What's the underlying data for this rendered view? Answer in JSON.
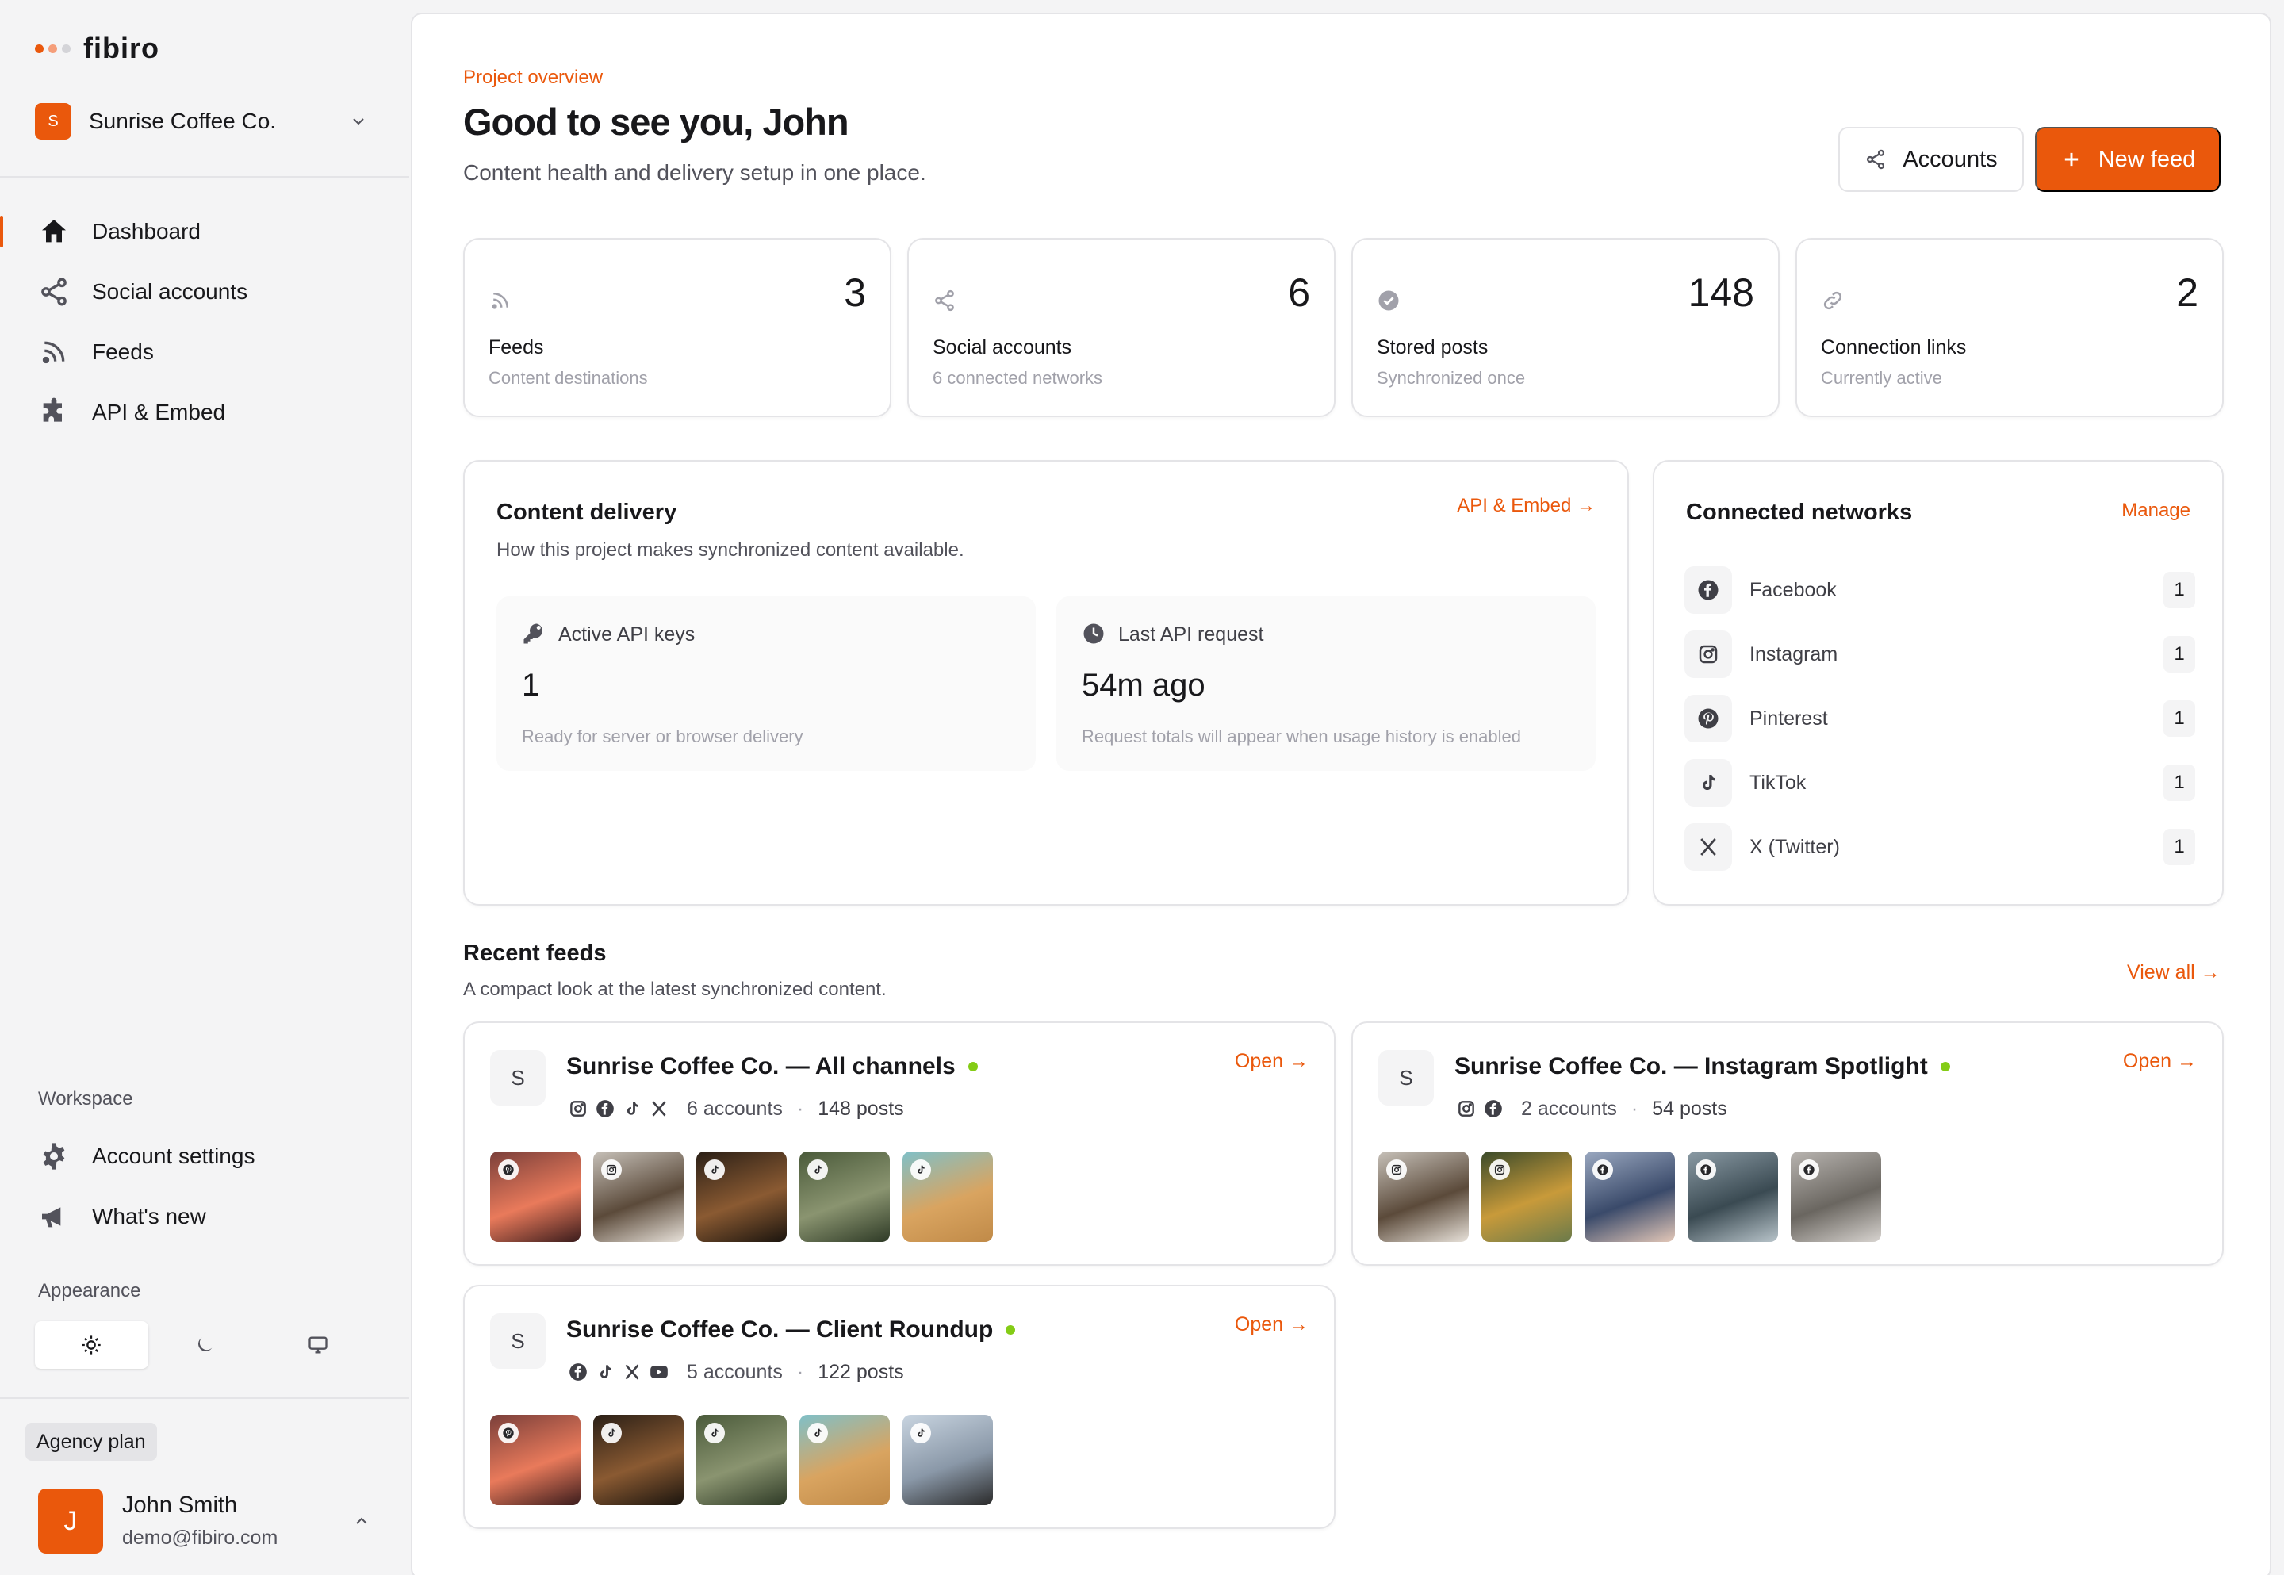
{
  "brand": {
    "name": "fibiro",
    "dot_colors": [
      "#ea580c",
      "#f59e7a",
      "#d4d4d8"
    ]
  },
  "project": {
    "initial": "S",
    "name": "Sunrise Coffee Co."
  },
  "nav": [
    {
      "label": "Dashboard",
      "icon": "home-icon",
      "active": true
    },
    {
      "label": "Social accounts",
      "icon": "share-icon",
      "active": false
    },
    {
      "label": "Feeds",
      "icon": "rss-icon",
      "active": false
    },
    {
      "label": "API & Embed",
      "icon": "puzzle-icon",
      "active": false
    }
  ],
  "workspace": {
    "label": "Workspace",
    "items": [
      {
        "label": "Account settings",
        "icon": "gear-icon"
      },
      {
        "label": "What's new",
        "icon": "megaphone-icon"
      }
    ]
  },
  "appearance": {
    "label": "Appearance",
    "options": [
      "sun-icon",
      "moon-icon",
      "monitor-icon"
    ],
    "selected": "sun-icon"
  },
  "plan": {
    "label": "Agency plan"
  },
  "user": {
    "initial": "J",
    "name": "John Smith",
    "email": "demo@fibiro.com"
  },
  "header": {
    "eyebrow": "Project overview",
    "title": "Good to see you, John",
    "subtitle": "Content health and delivery setup in one place.",
    "accounts_button": "Accounts",
    "new_feed_button": "New feed"
  },
  "stats": [
    {
      "value": "3",
      "label": "Feeds",
      "sub": "Content destinations",
      "icon": "rss-icon"
    },
    {
      "value": "6",
      "label": "Social accounts",
      "sub": "6 connected networks",
      "icon": "share-icon"
    },
    {
      "value": "148",
      "label": "Stored posts",
      "sub": "Synchronized once",
      "icon": "check-circle-icon"
    },
    {
      "value": "2",
      "label": "Connection links",
      "sub": "Currently active",
      "icon": "link-icon"
    }
  ],
  "delivery": {
    "title": "Content delivery",
    "desc": "How this project makes synchronized content available.",
    "link": "API & Embed →",
    "boxes": [
      {
        "label": "Active API keys",
        "value": "1",
        "sub": "Ready for server or browser delivery",
        "icon": "key-icon"
      },
      {
        "label": "Last API request",
        "value": "54m ago",
        "sub": "Request totals will appear when usage history is enabled",
        "icon": "clock-icon"
      }
    ]
  },
  "networks": {
    "title": "Connected networks",
    "link": "Manage",
    "items": [
      {
        "name": "Facebook",
        "count": "1",
        "icon": "facebook-icon"
      },
      {
        "name": "Instagram",
        "count": "1",
        "icon": "instagram-icon"
      },
      {
        "name": "Pinterest",
        "count": "1",
        "icon": "pinterest-icon"
      },
      {
        "name": "TikTok",
        "count": "1",
        "icon": "tiktok-icon"
      },
      {
        "name": "X (Twitter)",
        "count": "1",
        "icon": "x-icon"
      }
    ]
  },
  "recent": {
    "title": "Recent feeds",
    "desc": "A compact look at the latest synchronized content.",
    "view_all": "View all →",
    "feeds": [
      {
        "initial": "S",
        "title": "Sunrise Coffee Co. — All channels",
        "open": "Open →",
        "network_icons": [
          "instagram-icon",
          "facebook-icon",
          "tiktok-icon",
          "x-icon"
        ],
        "accounts": "6 accounts",
        "posts": "148 posts",
        "thumbs": [
          {
            "badge": "pinterest-icon",
            "colors": [
              "#7a3f3a",
              "#e97a5b",
              "#3a1c1c"
            ]
          },
          {
            "badge": "instagram-icon",
            "colors": [
              "#c6c0b8",
              "#5b4a3a",
              "#e8e2da"
            ]
          },
          {
            "badge": "tiktok-icon",
            "colors": [
              "#2a1f16",
              "#8a5a32",
              "#1a140e"
            ]
          },
          {
            "badge": "tiktok-icon",
            "colors": [
              "#4a5a3a",
              "#8a9470",
              "#2e3a26"
            ]
          },
          {
            "badge": "tiktok-icon",
            "colors": [
              "#7fc0c8",
              "#d9a460",
              "#c08a48"
            ]
          }
        ]
      },
      {
        "initial": "S",
        "title": "Sunrise Coffee Co. — Instagram Spotlight",
        "open": "Open →",
        "network_icons": [
          "instagram-icon",
          "facebook-icon"
        ],
        "accounts": "2 accounts",
        "posts": "54 posts",
        "thumbs": [
          {
            "badge": "instagram-icon",
            "colors": [
              "#c6c0b8",
              "#5b4a3a",
              "#e8e2da"
            ]
          },
          {
            "badge": "instagram-icon",
            "colors": [
              "#3a4a2a",
              "#c89a3a",
              "#6a7a4a"
            ]
          },
          {
            "badge": "facebook-icon",
            "colors": [
              "#9aa8c0",
              "#3a4a6a",
              "#e4c8b8"
            ]
          },
          {
            "badge": "facebook-icon",
            "colors": [
              "#8a9aa4",
              "#3a4a52",
              "#b8c4ca"
            ]
          },
          {
            "badge": "facebook-icon",
            "colors": [
              "#b8b4b0",
              "#6a6660",
              "#d8d4d0"
            ]
          }
        ]
      },
      {
        "initial": "S",
        "title": "Sunrise Coffee Co. — Client Roundup",
        "open": "Open →",
        "network_icons": [
          "facebook-icon",
          "tiktok-icon",
          "x-icon",
          "youtube-icon"
        ],
        "accounts": "5 accounts",
        "posts": "122 posts",
        "thumbs": [
          {
            "badge": "pinterest-icon",
            "colors": [
              "#7a3f3a",
              "#e97a5b",
              "#3a1c1c"
            ]
          },
          {
            "badge": "tiktok-icon",
            "colors": [
              "#2a1f16",
              "#8a5a32",
              "#1a140e"
            ]
          },
          {
            "badge": "tiktok-icon",
            "colors": [
              "#4a5a3a",
              "#8a9470",
              "#2e3a26"
            ]
          },
          {
            "badge": "tiktok-icon",
            "colors": [
              "#7fc0c8",
              "#d9a460",
              "#c08a48"
            ]
          },
          {
            "badge": "tiktok-icon",
            "colors": [
              "#c8d4e0",
              "#8a98a8",
              "#2a2a2a"
            ]
          }
        ]
      }
    ]
  },
  "colors": {
    "accent": "#ea580c",
    "live": "#84cc16"
  }
}
